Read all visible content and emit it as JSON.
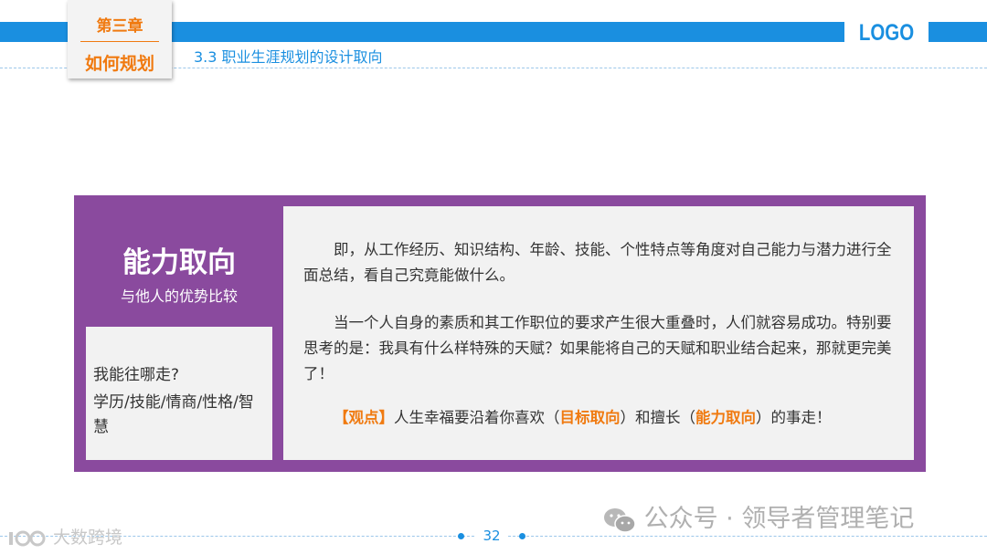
{
  "header": {
    "chapter_number": "第三章",
    "chapter_title": "如何规划",
    "section_title": "3.3 职业生涯规划的设计取向",
    "logo": "LOGO"
  },
  "panel": {
    "heading": "能力取向",
    "subheading": "与他人的优势比较",
    "side_question": "我能往哪走?",
    "side_items": "学历/技能/情商/性格/智慧",
    "paragraphs": {
      "p1": "即，从工作经历、知识结构、年龄、技能、个性特点等角度对自己能力与潜力进行全面总结，看自己究竟能做什么。",
      "p2": "当一个人自身的素质和其工作职位的要求产生很大重叠时，人们就容易成功。特别要思考的是：我具有什么样特殊的天赋？如果能将自己的天赋和职业结合起来，那就更完美了！",
      "p3": {
        "tag": "【观点】",
        "t1": "人生幸福要沿着你喜欢（",
        "h1": "目标取向",
        "t2": "）和擅长（",
        "h2": "能力取向",
        "t3": "）的事走！"
      }
    }
  },
  "footer": {
    "page_number": "32",
    "watermark_right": "公众号 · 领导者管理笔记",
    "watermark_left": "大数跨境"
  },
  "colors": {
    "accent_blue": "#1a8fe0",
    "panel_purple": "#8a4a9e",
    "highlight_orange": "#f07a10"
  }
}
